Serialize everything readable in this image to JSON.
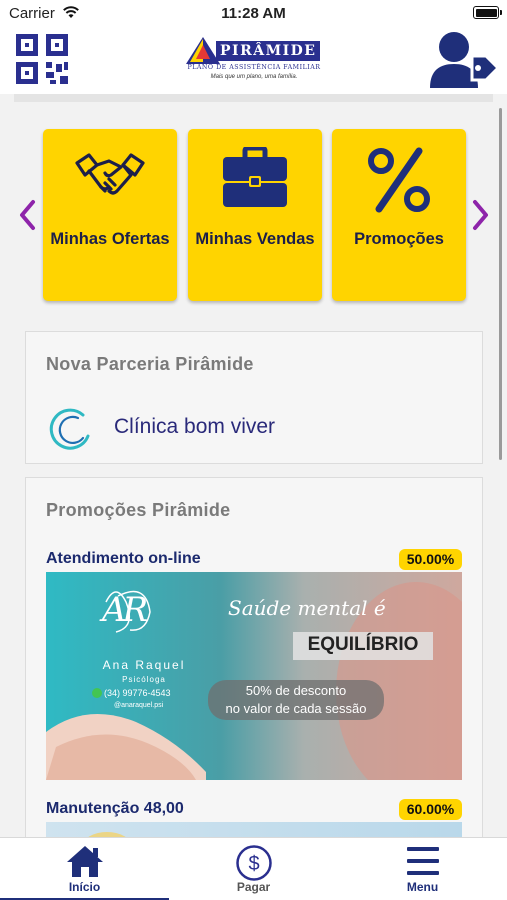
{
  "status_bar": {
    "carrier": "Carrier",
    "time": "11:28 AM"
  },
  "header": {
    "logo": {
      "name": "PIRÂMIDE",
      "subtitle": "PLANO DE ASSISTÊNCIA FAMILIAR",
      "registered": "®",
      "tagline": "Mais que um plano, uma família."
    }
  },
  "carousel": {
    "tiles": [
      {
        "label": "Minhas Ofertas",
        "icon": "handshake-icon"
      },
      {
        "label": "Minhas Vendas",
        "icon": "briefcase-icon"
      },
      {
        "label": "Promoções",
        "icon": "percent-icon"
      }
    ]
  },
  "partnership": {
    "title": "Nova Parceria Pirâmide",
    "partner_name": "Clínica bom viver"
  },
  "promotions": {
    "title": "Promoções Pirâmide",
    "items": [
      {
        "title": "Atendimento on-line",
        "discount": "50.00%",
        "banner": {
          "initials": "AR",
          "name": "Ana Raquel",
          "role": "Psicóloga",
          "phone": "(34) 99776-4543",
          "handle": "@anaraquel.psi",
          "headline": "Saúde mental é",
          "highlight": "EQUILÍBRIO",
          "offer_line1": "50% de desconto",
          "offer_line2": "no valor de cada sessão"
        }
      },
      {
        "title": "Manutenção 48,00",
        "discount": "60.00%"
      }
    ]
  },
  "tabbar": {
    "tabs": [
      {
        "label": "Início",
        "active": true
      },
      {
        "label": "Pagar",
        "active": false
      },
      {
        "label": "Menu",
        "active": false
      }
    ]
  },
  "colors": {
    "brand_navy": "#1f2f7a",
    "tile_yellow": "#ffd400",
    "arrow_purple": "#8e24aa",
    "teal": "#2fb9c3"
  }
}
